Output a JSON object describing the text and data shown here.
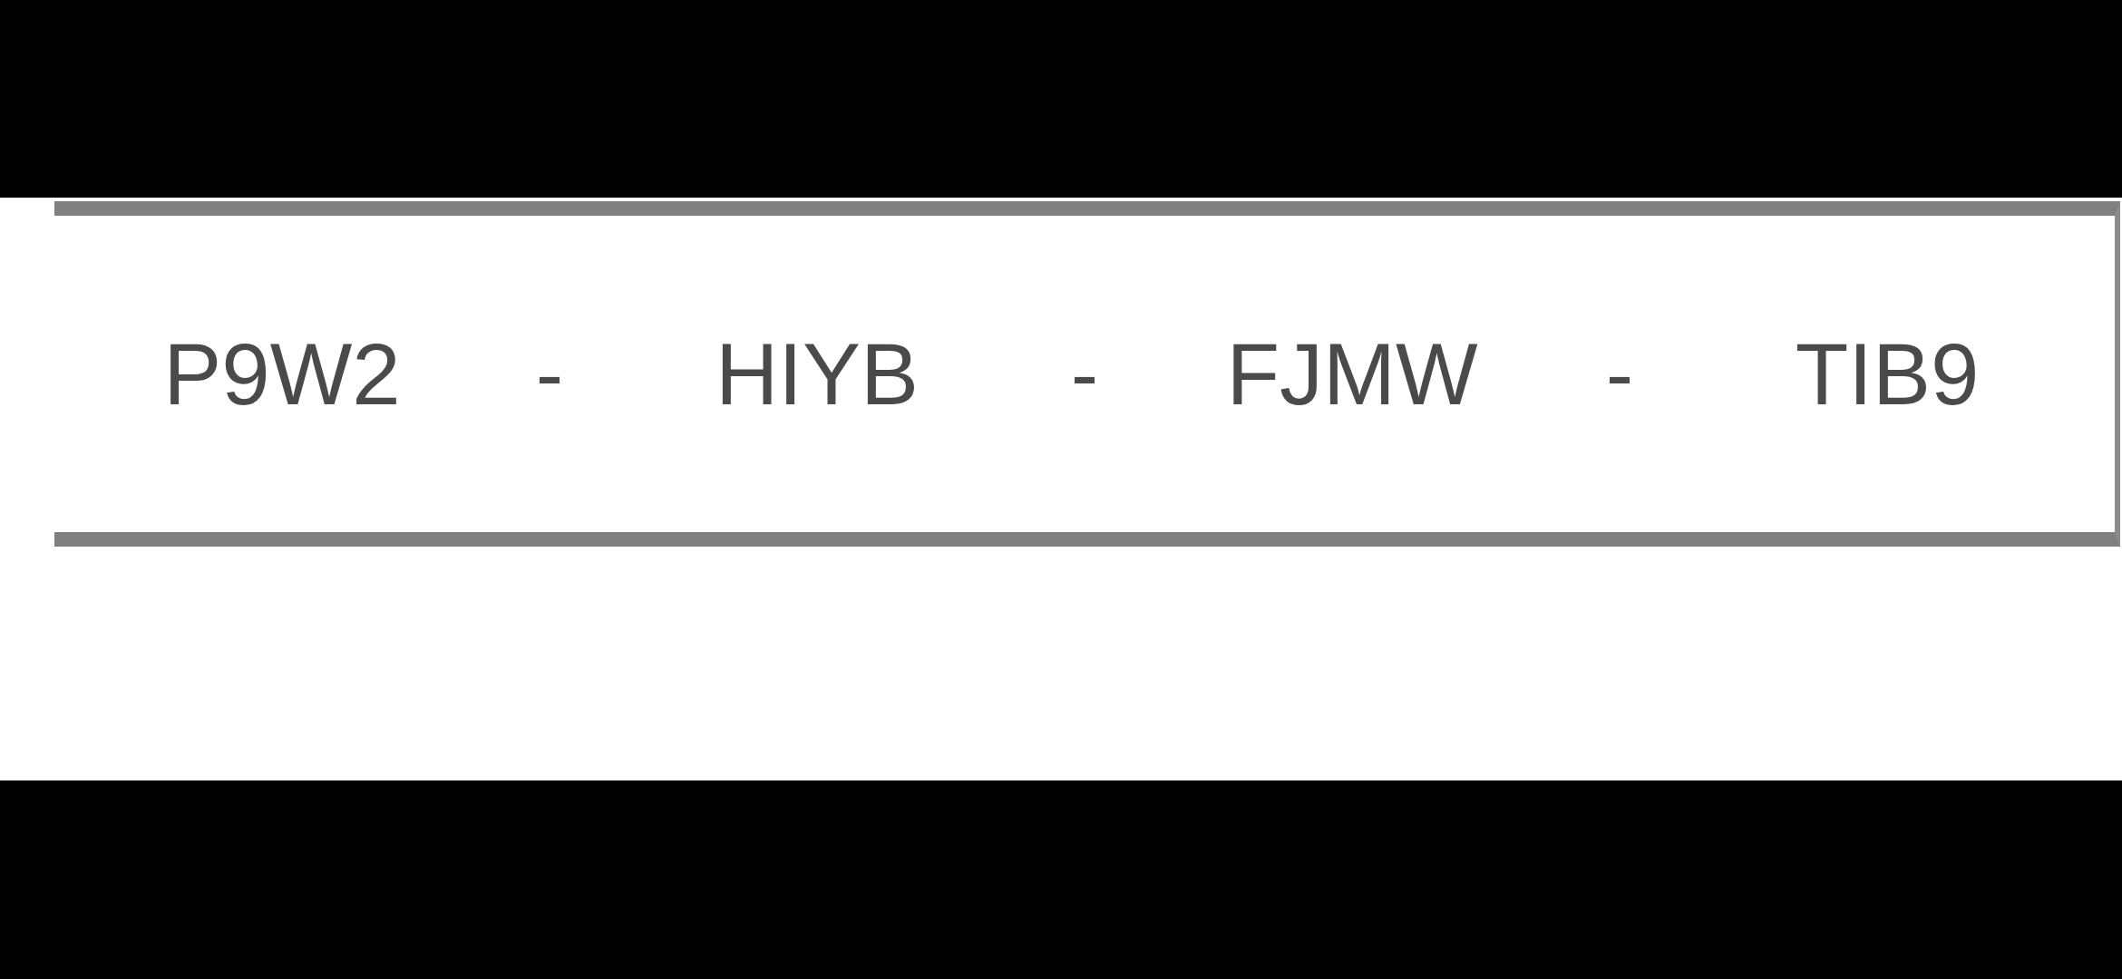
{
  "code_display": {
    "items": [
      {
        "kind": "group",
        "text": "P9W2"
      },
      {
        "kind": "separator",
        "text": "-"
      },
      {
        "kind": "group",
        "text": "HIYB"
      },
      {
        "kind": "separator",
        "text": "-"
      },
      {
        "kind": "group",
        "text": "FJMW"
      },
      {
        "kind": "separator",
        "text": "-"
      },
      {
        "kind": "group",
        "text": "TIB9"
      }
    ]
  }
}
